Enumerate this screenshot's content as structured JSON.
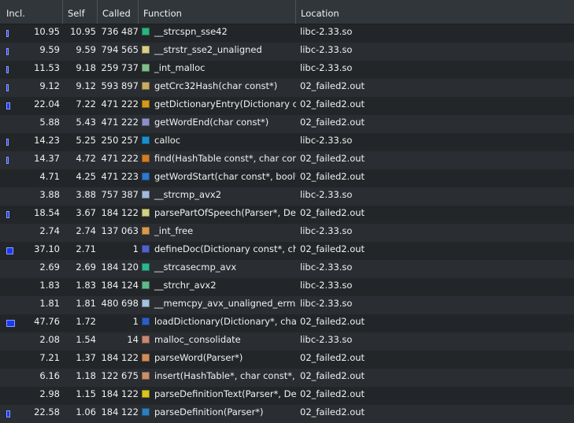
{
  "columns": {
    "incl": "Incl.",
    "self": "Self",
    "called": "Called",
    "function": "Function",
    "location": "Location"
  },
  "rows": [
    {
      "incl": "10.95",
      "self": "10.95",
      "called": "736 487",
      "function": "__strcspn_sse42",
      "location": "libc-2.33.so",
      "color": "#2ab37b",
      "incl_bar": 0.1095,
      "self_bar": 0.1095
    },
    {
      "incl": "9.59",
      "self": "9.59",
      "called": "794 565",
      "function": "__strstr_sse2_unaligned",
      "location": "libc-2.33.so",
      "color": "#d9cf86",
      "incl_bar": 0.0959,
      "self_bar": 0
    },
    {
      "incl": "11.53",
      "self": "9.18",
      "called": "259 737",
      "function": "_int_malloc",
      "location": "libc-2.33.so",
      "color": "#7ec08a",
      "incl_bar": 0.1153,
      "self_bar": 0.0918
    },
    {
      "incl": "9.12",
      "self": "9.12",
      "called": "593 897",
      "function": "getCrc32Hash(char const*)",
      "location": "02_failed2.out",
      "color": "#c7ad63",
      "incl_bar": 0.0912,
      "self_bar": 0.0912
    },
    {
      "incl": "22.04",
      "self": "7.22",
      "called": "471 222",
      "function": "getDictionaryEntry(Dictionary c…",
      "location": "02_failed2.out",
      "color": "#d49a1a",
      "incl_bar": 0.2204,
      "self_bar": 0
    },
    {
      "incl": "5.88",
      "self": "5.43",
      "called": "471 222",
      "function": "getWordEnd(char const*)",
      "location": "02_failed2.out",
      "color": "#8d8fc8",
      "incl_bar": 0,
      "self_bar": 0
    },
    {
      "incl": "14.23",
      "self": "5.25",
      "called": "250 257",
      "function": "calloc",
      "location": "libc-2.33.so",
      "color": "#1a8fd0",
      "incl_bar": 0.1423,
      "self_bar": 0
    },
    {
      "incl": "14.37",
      "self": "4.72",
      "called": "471 222",
      "function": "find(HashTable const*, char con…",
      "location": "02_failed2.out",
      "color": "#d27e24",
      "incl_bar": 0.1437,
      "self_bar": 0
    },
    {
      "incl": "4.71",
      "self": "4.25",
      "called": "471 223",
      "function": "getWordStart(char const*, bool*)",
      "location": "02_failed2.out",
      "color": "#2f78cf",
      "incl_bar": 0,
      "self_bar": 0
    },
    {
      "incl": "3.88",
      "self": "3.88",
      "called": "757 387",
      "function": "__strcmp_avx2",
      "location": "libc-2.33.so",
      "color": "#a6b8d8",
      "incl_bar": 0,
      "self_bar": 0
    },
    {
      "incl": "18.54",
      "self": "3.67",
      "called": "184 122",
      "function": "parsePartOfSpeech(Parser*, De…",
      "location": "02_failed2.out",
      "color": "#d1d281",
      "incl_bar": 0.1854,
      "self_bar": 0
    },
    {
      "incl": "2.74",
      "self": "2.74",
      "called": "137 063",
      "function": "_int_free",
      "location": "libc-2.33.so",
      "color": "#d99a4e",
      "incl_bar": 0,
      "self_bar": 0
    },
    {
      "incl": "37.10",
      "self": "2.71",
      "called": "1",
      "function": "defineDoc(Dictionary const*, ch…",
      "location": "02_failed2.out",
      "color": "#4f63c9",
      "incl_bar": 0.371,
      "self_bar": 0
    },
    {
      "incl": "2.69",
      "self": "2.69",
      "called": "184 120",
      "function": "__strcasecmp_avx",
      "location": "libc-2.33.so",
      "color": "#2bb88a",
      "incl_bar": 0,
      "self_bar": 0
    },
    {
      "incl": "1.83",
      "self": "1.83",
      "called": "184 124",
      "function": "__strchr_avx2",
      "location": "libc-2.33.so",
      "color": "#5fb98a",
      "incl_bar": 0,
      "self_bar": 0
    },
    {
      "incl": "1.81",
      "self": "1.81",
      "called": "480 698",
      "function": "__memcpy_avx_unaligned_erms",
      "location": "libc-2.33.so",
      "color": "#a7c0de",
      "incl_bar": 0,
      "self_bar": 0
    },
    {
      "incl": "47.76",
      "self": "1.72",
      "called": "1",
      "function": "loadDictionary(Dictionary*, cha…",
      "location": "02_failed2.out",
      "color": "#2b5fc7",
      "incl_bar": 0.4776,
      "self_bar": 0
    },
    {
      "incl": "2.08",
      "self": "1.54",
      "called": "14",
      "function": "malloc_consolidate",
      "location": "libc-2.33.so",
      "color": "#c98870",
      "incl_bar": 0,
      "self_bar": 0
    },
    {
      "incl": "7.21",
      "self": "1.37",
      "called": "184 122",
      "function": "parseWord(Parser*)",
      "location": "02_failed2.out",
      "color": "#d48a58",
      "incl_bar": 0,
      "self_bar": 0
    },
    {
      "incl": "6.16",
      "self": "1.18",
      "called": "122 675",
      "function": "insert(HashTable*, char const*, …",
      "location": "02_failed2.out",
      "color": "#c7906a",
      "incl_bar": 0,
      "self_bar": 0
    },
    {
      "incl": "2.98",
      "self": "1.15",
      "called": "184 122",
      "function": "parseDefinitionText(Parser*, De…",
      "location": "02_failed2.out",
      "color": "#d6c61f",
      "incl_bar": 0,
      "self_bar": 0
    },
    {
      "incl": "22.58",
      "self": "1.06",
      "called": "184 122",
      "function": "parseDefinition(Parser*)",
      "location": "02_failed2.out",
      "color": "#2b7fbf",
      "incl_bar": 0.2258,
      "self_bar": 0
    }
  ]
}
